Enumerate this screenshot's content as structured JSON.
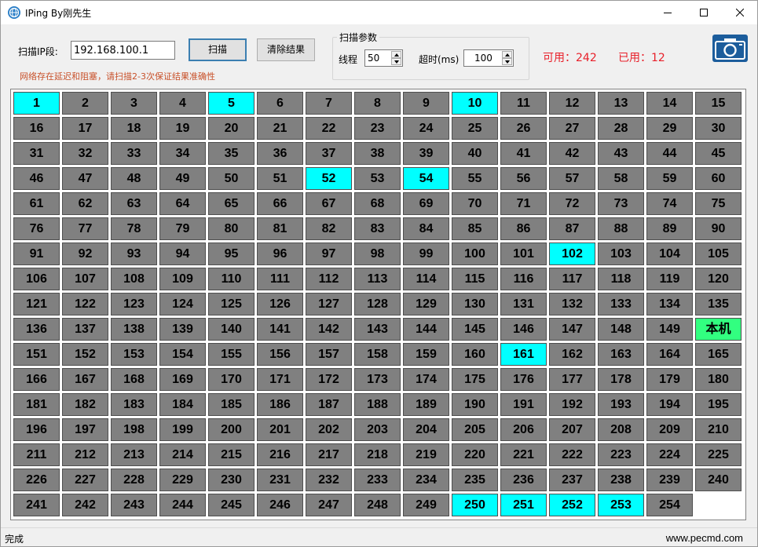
{
  "window": {
    "title": "IPing By刚先生"
  },
  "toolbar": {
    "ip_label": "扫描IP段:",
    "ip_value": "192.168.100.1",
    "scan_label": "扫描",
    "clear_label": "清除结果",
    "warning": "网络存在延迟和阻塞，请扫描2-3次保证结果准确性"
  },
  "params": {
    "title": "扫描参数",
    "thread_label": "线程",
    "thread_value": "50",
    "timeout_label": "超时(ms)",
    "timeout_value": "100"
  },
  "stats": {
    "available": "可用：242",
    "used": "已用：12"
  },
  "grid": {
    "columns": 15,
    "cells": [
      {
        "label": "1",
        "state": "on"
      },
      {
        "label": "2",
        "state": "off"
      },
      {
        "label": "3",
        "state": "off"
      },
      {
        "label": "4",
        "state": "off"
      },
      {
        "label": "5",
        "state": "on"
      },
      {
        "label": "6",
        "state": "off"
      },
      {
        "label": "7",
        "state": "off"
      },
      {
        "label": "8",
        "state": "off"
      },
      {
        "label": "9",
        "state": "off"
      },
      {
        "label": "10",
        "state": "on"
      },
      {
        "label": "11",
        "state": "off"
      },
      {
        "label": "12",
        "state": "off"
      },
      {
        "label": "13",
        "state": "off"
      },
      {
        "label": "14",
        "state": "off"
      },
      {
        "label": "15",
        "state": "off"
      },
      {
        "label": "16",
        "state": "off"
      },
      {
        "label": "17",
        "state": "off"
      },
      {
        "label": "18",
        "state": "off"
      },
      {
        "label": "19",
        "state": "off"
      },
      {
        "label": "20",
        "state": "off"
      },
      {
        "label": "21",
        "state": "off"
      },
      {
        "label": "22",
        "state": "off"
      },
      {
        "label": "23",
        "state": "off"
      },
      {
        "label": "24",
        "state": "off"
      },
      {
        "label": "25",
        "state": "off"
      },
      {
        "label": "26",
        "state": "off"
      },
      {
        "label": "27",
        "state": "off"
      },
      {
        "label": "28",
        "state": "off"
      },
      {
        "label": "29",
        "state": "off"
      },
      {
        "label": "30",
        "state": "off"
      },
      {
        "label": "31",
        "state": "off"
      },
      {
        "label": "32",
        "state": "off"
      },
      {
        "label": "33",
        "state": "off"
      },
      {
        "label": "34",
        "state": "off"
      },
      {
        "label": "35",
        "state": "off"
      },
      {
        "label": "36",
        "state": "off"
      },
      {
        "label": "37",
        "state": "off"
      },
      {
        "label": "38",
        "state": "off"
      },
      {
        "label": "39",
        "state": "off"
      },
      {
        "label": "40",
        "state": "off"
      },
      {
        "label": "41",
        "state": "off"
      },
      {
        "label": "42",
        "state": "off"
      },
      {
        "label": "43",
        "state": "off"
      },
      {
        "label": "44",
        "state": "off"
      },
      {
        "label": "45",
        "state": "off"
      },
      {
        "label": "46",
        "state": "off"
      },
      {
        "label": "47",
        "state": "off"
      },
      {
        "label": "48",
        "state": "off"
      },
      {
        "label": "49",
        "state": "off"
      },
      {
        "label": "50",
        "state": "off"
      },
      {
        "label": "51",
        "state": "off"
      },
      {
        "label": "52",
        "state": "on"
      },
      {
        "label": "53",
        "state": "off"
      },
      {
        "label": "54",
        "state": "on"
      },
      {
        "label": "55",
        "state": "off"
      },
      {
        "label": "56",
        "state": "off"
      },
      {
        "label": "57",
        "state": "off"
      },
      {
        "label": "58",
        "state": "off"
      },
      {
        "label": "59",
        "state": "off"
      },
      {
        "label": "60",
        "state": "off"
      },
      {
        "label": "61",
        "state": "off"
      },
      {
        "label": "62",
        "state": "off"
      },
      {
        "label": "63",
        "state": "off"
      },
      {
        "label": "64",
        "state": "off"
      },
      {
        "label": "65",
        "state": "off"
      },
      {
        "label": "66",
        "state": "off"
      },
      {
        "label": "67",
        "state": "off"
      },
      {
        "label": "68",
        "state": "off"
      },
      {
        "label": "69",
        "state": "off"
      },
      {
        "label": "70",
        "state": "off"
      },
      {
        "label": "71",
        "state": "off"
      },
      {
        "label": "72",
        "state": "off"
      },
      {
        "label": "73",
        "state": "off"
      },
      {
        "label": "74",
        "state": "off"
      },
      {
        "label": "75",
        "state": "off"
      },
      {
        "label": "76",
        "state": "off"
      },
      {
        "label": "77",
        "state": "off"
      },
      {
        "label": "78",
        "state": "off"
      },
      {
        "label": "79",
        "state": "off"
      },
      {
        "label": "80",
        "state": "off"
      },
      {
        "label": "81",
        "state": "off"
      },
      {
        "label": "82",
        "state": "off"
      },
      {
        "label": "83",
        "state": "off"
      },
      {
        "label": "84",
        "state": "off"
      },
      {
        "label": "85",
        "state": "off"
      },
      {
        "label": "86",
        "state": "off"
      },
      {
        "label": "87",
        "state": "off"
      },
      {
        "label": "88",
        "state": "off"
      },
      {
        "label": "89",
        "state": "off"
      },
      {
        "label": "90",
        "state": "off"
      },
      {
        "label": "91",
        "state": "off"
      },
      {
        "label": "92",
        "state": "off"
      },
      {
        "label": "93",
        "state": "off"
      },
      {
        "label": "94",
        "state": "off"
      },
      {
        "label": "95",
        "state": "off"
      },
      {
        "label": "96",
        "state": "off"
      },
      {
        "label": "97",
        "state": "off"
      },
      {
        "label": "98",
        "state": "off"
      },
      {
        "label": "99",
        "state": "off"
      },
      {
        "label": "100",
        "state": "off"
      },
      {
        "label": "101",
        "state": "off"
      },
      {
        "label": "102",
        "state": "on"
      },
      {
        "label": "103",
        "state": "off"
      },
      {
        "label": "104",
        "state": "off"
      },
      {
        "label": "105",
        "state": "off"
      },
      {
        "label": "106",
        "state": "off"
      },
      {
        "label": "107",
        "state": "off"
      },
      {
        "label": "108",
        "state": "off"
      },
      {
        "label": "109",
        "state": "off"
      },
      {
        "label": "110",
        "state": "off"
      },
      {
        "label": "111",
        "state": "off"
      },
      {
        "label": "112",
        "state": "off"
      },
      {
        "label": "113",
        "state": "off"
      },
      {
        "label": "114",
        "state": "off"
      },
      {
        "label": "115",
        "state": "off"
      },
      {
        "label": "116",
        "state": "off"
      },
      {
        "label": "117",
        "state": "off"
      },
      {
        "label": "118",
        "state": "off"
      },
      {
        "label": "119",
        "state": "off"
      },
      {
        "label": "120",
        "state": "off"
      },
      {
        "label": "121",
        "state": "off"
      },
      {
        "label": "122",
        "state": "off"
      },
      {
        "label": "123",
        "state": "off"
      },
      {
        "label": "124",
        "state": "off"
      },
      {
        "label": "125",
        "state": "off"
      },
      {
        "label": "126",
        "state": "off"
      },
      {
        "label": "127",
        "state": "off"
      },
      {
        "label": "128",
        "state": "off"
      },
      {
        "label": "129",
        "state": "off"
      },
      {
        "label": "130",
        "state": "off"
      },
      {
        "label": "131",
        "state": "off"
      },
      {
        "label": "132",
        "state": "off"
      },
      {
        "label": "133",
        "state": "off"
      },
      {
        "label": "134",
        "state": "off"
      },
      {
        "label": "135",
        "state": "off"
      },
      {
        "label": "136",
        "state": "off"
      },
      {
        "label": "137",
        "state": "off"
      },
      {
        "label": "138",
        "state": "off"
      },
      {
        "label": "139",
        "state": "off"
      },
      {
        "label": "140",
        "state": "off"
      },
      {
        "label": "141",
        "state": "off"
      },
      {
        "label": "142",
        "state": "off"
      },
      {
        "label": "143",
        "state": "off"
      },
      {
        "label": "144",
        "state": "off"
      },
      {
        "label": "145",
        "state": "off"
      },
      {
        "label": "146",
        "state": "off"
      },
      {
        "label": "147",
        "state": "off"
      },
      {
        "label": "148",
        "state": "off"
      },
      {
        "label": "149",
        "state": "off"
      },
      {
        "label": "本机",
        "state": "self"
      },
      {
        "label": "151",
        "state": "off"
      },
      {
        "label": "152",
        "state": "off"
      },
      {
        "label": "153",
        "state": "off"
      },
      {
        "label": "154",
        "state": "off"
      },
      {
        "label": "155",
        "state": "off"
      },
      {
        "label": "156",
        "state": "off"
      },
      {
        "label": "157",
        "state": "off"
      },
      {
        "label": "158",
        "state": "off"
      },
      {
        "label": "159",
        "state": "off"
      },
      {
        "label": "160",
        "state": "off"
      },
      {
        "label": "161",
        "state": "on"
      },
      {
        "label": "162",
        "state": "off"
      },
      {
        "label": "163",
        "state": "off"
      },
      {
        "label": "164",
        "state": "off"
      },
      {
        "label": "165",
        "state": "off"
      },
      {
        "label": "166",
        "state": "off"
      },
      {
        "label": "167",
        "state": "off"
      },
      {
        "label": "168",
        "state": "off"
      },
      {
        "label": "169",
        "state": "off"
      },
      {
        "label": "170",
        "state": "off"
      },
      {
        "label": "171",
        "state": "off"
      },
      {
        "label": "172",
        "state": "off"
      },
      {
        "label": "173",
        "state": "off"
      },
      {
        "label": "174",
        "state": "off"
      },
      {
        "label": "175",
        "state": "off"
      },
      {
        "label": "176",
        "state": "off"
      },
      {
        "label": "177",
        "state": "off"
      },
      {
        "label": "178",
        "state": "off"
      },
      {
        "label": "179",
        "state": "off"
      },
      {
        "label": "180",
        "state": "off"
      },
      {
        "label": "181",
        "state": "off"
      },
      {
        "label": "182",
        "state": "off"
      },
      {
        "label": "183",
        "state": "off"
      },
      {
        "label": "184",
        "state": "off"
      },
      {
        "label": "185",
        "state": "off"
      },
      {
        "label": "186",
        "state": "off"
      },
      {
        "label": "187",
        "state": "off"
      },
      {
        "label": "188",
        "state": "off"
      },
      {
        "label": "189",
        "state": "off"
      },
      {
        "label": "190",
        "state": "off"
      },
      {
        "label": "191",
        "state": "off"
      },
      {
        "label": "192",
        "state": "off"
      },
      {
        "label": "193",
        "state": "off"
      },
      {
        "label": "194",
        "state": "off"
      },
      {
        "label": "195",
        "state": "off"
      },
      {
        "label": "196",
        "state": "off"
      },
      {
        "label": "197",
        "state": "off"
      },
      {
        "label": "198",
        "state": "off"
      },
      {
        "label": "199",
        "state": "off"
      },
      {
        "label": "200",
        "state": "off"
      },
      {
        "label": "201",
        "state": "off"
      },
      {
        "label": "202",
        "state": "off"
      },
      {
        "label": "203",
        "state": "off"
      },
      {
        "label": "204",
        "state": "off"
      },
      {
        "label": "205",
        "state": "off"
      },
      {
        "label": "206",
        "state": "off"
      },
      {
        "label": "207",
        "state": "off"
      },
      {
        "label": "208",
        "state": "off"
      },
      {
        "label": "209",
        "state": "off"
      },
      {
        "label": "210",
        "state": "off"
      },
      {
        "label": "211",
        "state": "off"
      },
      {
        "label": "212",
        "state": "off"
      },
      {
        "label": "213",
        "state": "off"
      },
      {
        "label": "214",
        "state": "off"
      },
      {
        "label": "215",
        "state": "off"
      },
      {
        "label": "216",
        "state": "off"
      },
      {
        "label": "217",
        "state": "off"
      },
      {
        "label": "218",
        "state": "off"
      },
      {
        "label": "219",
        "state": "off"
      },
      {
        "label": "220",
        "state": "off"
      },
      {
        "label": "221",
        "state": "off"
      },
      {
        "label": "222",
        "state": "off"
      },
      {
        "label": "223",
        "state": "off"
      },
      {
        "label": "224",
        "state": "off"
      },
      {
        "label": "225",
        "state": "off"
      },
      {
        "label": "226",
        "state": "off"
      },
      {
        "label": "227",
        "state": "off"
      },
      {
        "label": "228",
        "state": "off"
      },
      {
        "label": "229",
        "state": "off"
      },
      {
        "label": "230",
        "state": "off"
      },
      {
        "label": "231",
        "state": "off"
      },
      {
        "label": "232",
        "state": "off"
      },
      {
        "label": "233",
        "state": "off"
      },
      {
        "label": "234",
        "state": "off"
      },
      {
        "label": "235",
        "state": "off"
      },
      {
        "label": "236",
        "state": "off"
      },
      {
        "label": "237",
        "state": "off"
      },
      {
        "label": "238",
        "state": "off"
      },
      {
        "label": "239",
        "state": "off"
      },
      {
        "label": "240",
        "state": "off"
      },
      {
        "label": "241",
        "state": "off"
      },
      {
        "label": "242",
        "state": "off"
      },
      {
        "label": "243",
        "state": "off"
      },
      {
        "label": "244",
        "state": "off"
      },
      {
        "label": "245",
        "state": "off"
      },
      {
        "label": "246",
        "state": "off"
      },
      {
        "label": "247",
        "state": "off"
      },
      {
        "label": "248",
        "state": "off"
      },
      {
        "label": "249",
        "state": "off"
      },
      {
        "label": "250",
        "state": "on"
      },
      {
        "label": "251",
        "state": "on"
      },
      {
        "label": "252",
        "state": "on"
      },
      {
        "label": "253",
        "state": "on"
      },
      {
        "label": "254",
        "state": "off"
      }
    ]
  },
  "status": {
    "text": "完成",
    "site": "www.pecmd.com"
  },
  "colors": {
    "online": "#00ffff",
    "offline": "#808080",
    "self": "#32ff80",
    "stat_text": "#e8202a",
    "warning_text": "#c8512a",
    "camera_bg": "#1c5d9c"
  },
  "icons": {
    "app": "globe-icon",
    "camera": "camera-icon",
    "minimize": "minimize-icon",
    "maximize": "maximize-icon",
    "close": "close-icon"
  }
}
